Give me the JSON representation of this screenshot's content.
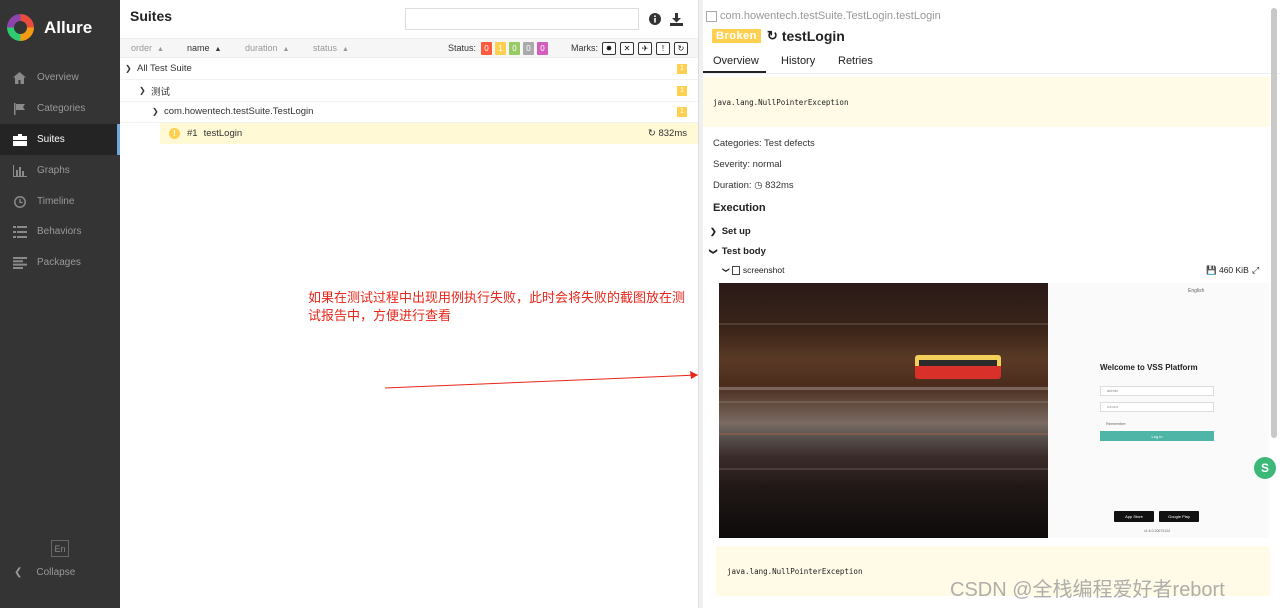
{
  "app": {
    "name": "Allure"
  },
  "sidebar": {
    "items": [
      {
        "label": "Overview",
        "icon": "home-icon"
      },
      {
        "label": "Categories",
        "icon": "flag-icon"
      },
      {
        "label": "Suites",
        "icon": "briefcase-icon",
        "active": true
      },
      {
        "label": "Graphs",
        "icon": "bar-chart-icon"
      },
      {
        "label": "Timeline",
        "icon": "clock-icon"
      },
      {
        "label": "Behaviors",
        "icon": "list-icon"
      },
      {
        "label": "Packages",
        "icon": "align-left-icon"
      }
    ],
    "language": "En",
    "collapse_label": "Collapse"
  },
  "suites": {
    "title": "Suites",
    "search_placeholder": "",
    "sort_columns": [
      "order",
      "name",
      "duration",
      "status"
    ],
    "status_label": "Status:",
    "status_counts": [
      "0",
      "1",
      "0",
      "0",
      "0"
    ],
    "status_colors": [
      "#fd5a3e",
      "#ffd050",
      "#97cc64",
      "#aaaaaa",
      "#d35ebe"
    ],
    "marks_label": "Marks:",
    "tree": [
      {
        "label": "All Test Suite",
        "count": "1"
      },
      {
        "label": "测试",
        "count": "1"
      },
      {
        "label": "com.howentech.testSuite.TestLogin",
        "count": "1"
      }
    ],
    "leaf": {
      "number": "#1",
      "name": "testLogin",
      "duration": "832ms"
    }
  },
  "annotation": "如果在测试过程中出现用例执行失败，此时会将失败的截图放在测试报告中，方便进行查看",
  "detail": {
    "breadcrumb": "com.howentech.testSuite.TestLogin.testLogin",
    "status": "Broken",
    "title": "testLogin",
    "tabs": [
      "Overview",
      "History",
      "Retries"
    ],
    "exception": "java.lang.NullPointerException",
    "categories": "Categories: Test defects",
    "severity": "Severity: normal",
    "duration_label": "Duration:",
    "duration": "832ms",
    "execution_title": "Execution",
    "setup_label": "Set up",
    "testbody_label": "Test body",
    "attachment": {
      "name": "screenshot",
      "size": "460 KiB"
    },
    "screenshot": {
      "language": "English",
      "welcome": "Welcome to VSS Platform",
      "username": "admin",
      "password": "••••••••",
      "remember": "Remember",
      "login": "Log in",
      "store1": "App Store",
      "store2": "Google Play",
      "version": "v1.6.0.20073124"
    },
    "exception2": "java.lang.NullPointerException"
  },
  "watermark": "CSDN @全栈编程爱好者rebort"
}
